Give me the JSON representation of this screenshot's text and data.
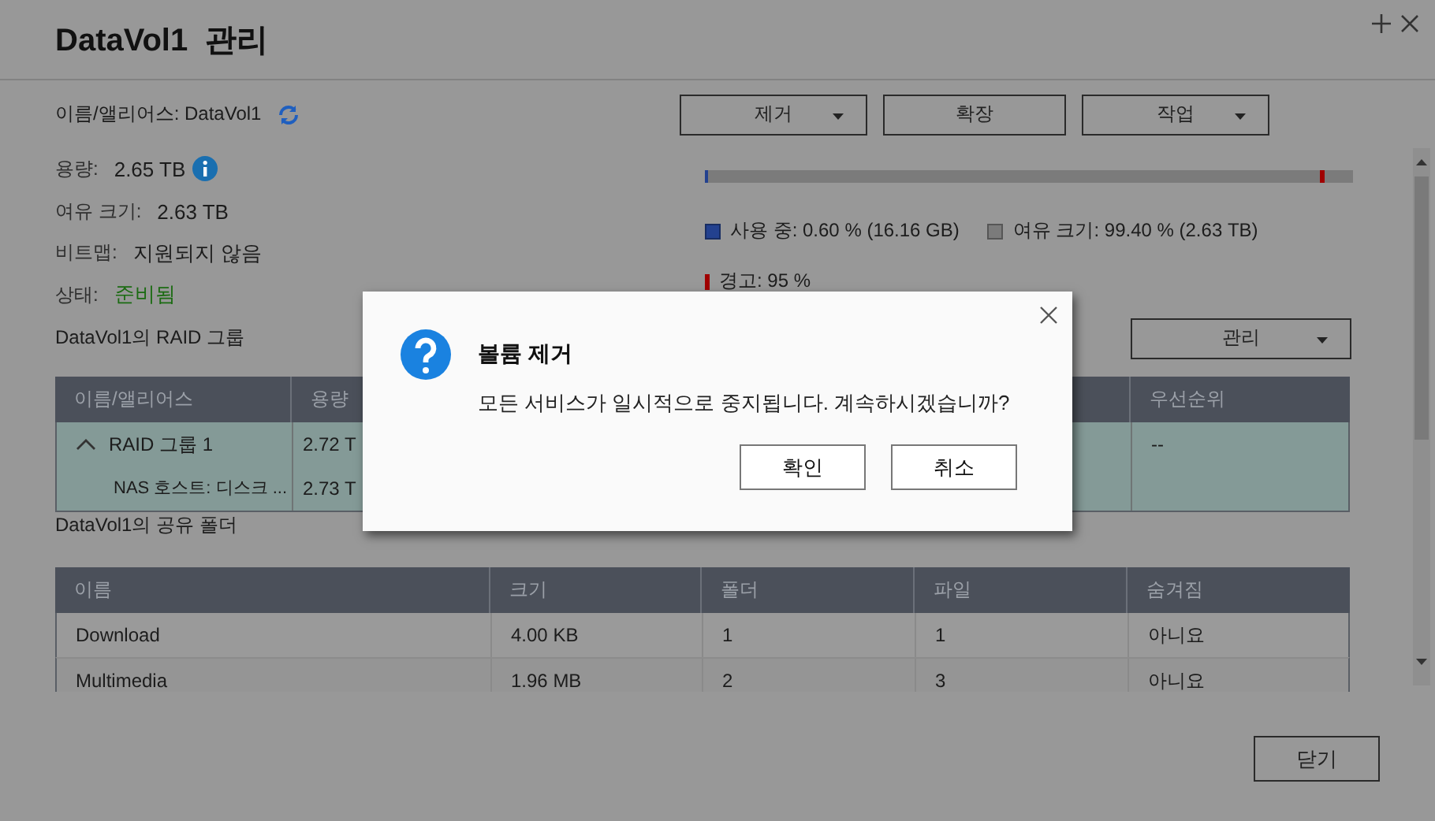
{
  "window": {
    "title": "DataVol1  관리"
  },
  "name_alias": {
    "label": "이름/앨리어스:",
    "value": "DataVol1"
  },
  "actions": [
    {
      "label": "제거",
      "dropdown": true
    },
    {
      "label": "확장",
      "dropdown": false
    },
    {
      "label": "작업",
      "dropdown": true
    }
  ],
  "properties": [
    {
      "label": "용량:",
      "value": "2.65 TB",
      "kind": "info"
    },
    {
      "label": "여유 크기:",
      "value": "2.63 TB",
      "kind": "plain"
    },
    {
      "label": "비트맵:",
      "value": "지원되지 않음",
      "kind": "plain"
    },
    {
      "label": "상태:",
      "value": "준비됨",
      "kind": "status"
    }
  ],
  "usage": {
    "level": 0.006,
    "warning_marker": {
      "level": 0.95
    },
    "legend": [
      {
        "label": "사용 중: 0.60 % (16.16 GB)",
        "color": "#23418f"
      },
      {
        "label": "여유 크기: 99.40 % (2.63 TB)",
        "color": "#7b7b7b"
      }
    ],
    "warning": "경고: 95 %"
  },
  "raid_section": {
    "title": "DataVol1의 RAID 그룹",
    "manage_button": "관리",
    "columns": [
      "이름/앨리어스",
      "용량",
      "우선순위"
    ],
    "rows": [
      {
        "name": "RAID 그룹 1",
        "capacity": "2.72 T",
        "priority": "--",
        "expanded": true,
        "selected": true,
        "children": [
          {
            "name": "NAS 호스트: 디스크 ...",
            "capacity": "2.73 T",
            "selected": true
          }
        ]
      }
    ]
  },
  "shared_section": {
    "title": "DataVol1의 공유 폴더",
    "columns": [
      "이름",
      "크기",
      "폴더",
      "파일",
      "숨겨짐"
    ],
    "rows": [
      [
        "Download",
        "4.00 KB",
        "1",
        "1",
        "아니요"
      ],
      [
        "Multimedia",
        "1.96 MB",
        "2",
        "3",
        "아니요"
      ]
    ]
  },
  "close_button": "닫기",
  "dialog": {
    "title": "볼륨 제거",
    "message": "모든 서비스가 일시적으로 중지됩니다. 계속하시겠습니까?",
    "buttons": [
      "확인",
      "취소"
    ]
  }
}
